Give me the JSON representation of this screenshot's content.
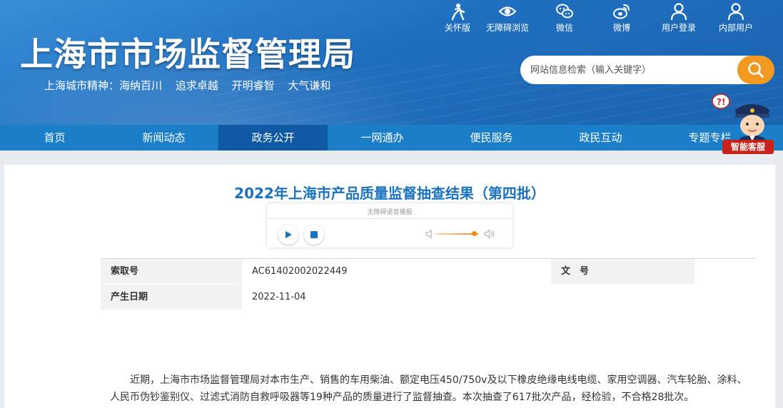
{
  "header": {
    "site_title": "上海市市场监督管理局",
    "slogan": [
      "上海城市精神：海纳百川",
      "追求卓越",
      "开明睿智",
      "大气谦和"
    ],
    "top_links": [
      {
        "label": "关怀版",
        "icon": "elderly-care-icon"
      },
      {
        "label": "无障碍浏览",
        "icon": "eye-icon"
      },
      {
        "label": "微信",
        "icon": "wechat-icon"
      },
      {
        "label": "微博",
        "icon": "weibo-icon"
      },
      {
        "label": "用户登录",
        "icon": "user-icon"
      },
      {
        "label": "内部用户",
        "icon": "user-icon"
      }
    ],
    "search": {
      "placeholder": "网站信息检索（输入关键字）",
      "icon": "search-icon"
    }
  },
  "nav": {
    "items": [
      "首页",
      "新闻动态",
      "政务公开",
      "一网通办",
      "便民服务",
      "政民互动",
      "专题专栏"
    ],
    "active_index": 2
  },
  "chatbot": {
    "label": "智能客服"
  },
  "article": {
    "title": "2022年上海市产品质量监督抽查结果（第四批）",
    "player": {
      "label": "无障碍语音播报",
      "volume": 0.9
    },
    "meta": {
      "index_label": "索取号",
      "index_value": "AC61402002022449",
      "doc_label": "文　号",
      "doc_value": "",
      "date_label": "产生日期",
      "date_value": "2022-11-04"
    },
    "paragraph": "近期，上海市市场监督管理局对本市生产、销售的车用柴油、额定电压450/750v及以下橡皮绝缘电线电缆、家用空调器、汽车轮胎、涂料、人民币伪钞鉴别仪、过滤式消防自救呼吸器等19种产品的质量进行了监督抽查。本次抽查了617批次产品，经检验，不合格28批次。"
  },
  "colors": {
    "brand_blue": "#1b7ec9",
    "nav_active": "#0f5aa4",
    "title_blue": "#1a73c0",
    "search_orange": "#f29a20",
    "chatbot_red": "#c8231b"
  }
}
